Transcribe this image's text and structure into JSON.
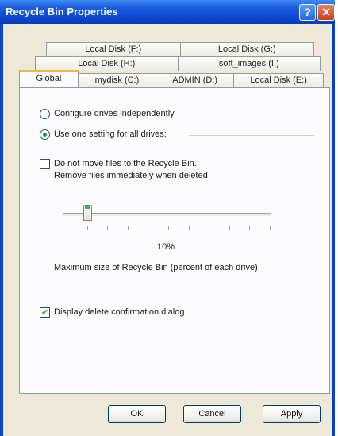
{
  "window": {
    "title": "Recycle Bin Properties",
    "help_label": "?",
    "close_label": "✕"
  },
  "tabs": {
    "row1": [
      "Local Disk (F:)",
      "Local Disk (G:)"
    ],
    "row2": [
      "Local Disk (H:)",
      "soft_images (I:)"
    ],
    "row3": [
      "Global",
      "mydisk (C:)",
      "ADMIN (D:)",
      "Local Disk (E:)"
    ],
    "active": "Global"
  },
  "global": {
    "radio_independent": "Configure drives independently",
    "radio_one_setting": "Use one setting for all drives:",
    "radio_selected": "one_setting",
    "no_move_line1": "Do not move files to the Recycle Bin.",
    "no_move_line2": "Remove files immediately when deleted",
    "no_move_checked": false,
    "slider_percent": 10,
    "slider_value_text": "10%",
    "slider_caption": "Maximum size of Recycle Bin (percent of each drive)",
    "confirm_label": "Display delete confirmation dialog",
    "confirm_checked": true
  },
  "buttons": {
    "ok": "OK",
    "cancel": "Cancel",
    "apply": "Apply"
  },
  "colors": {
    "titlebar": "#0d49d3",
    "active_tab_accent": "#f4b64a",
    "check_mark": "#21a121"
  }
}
